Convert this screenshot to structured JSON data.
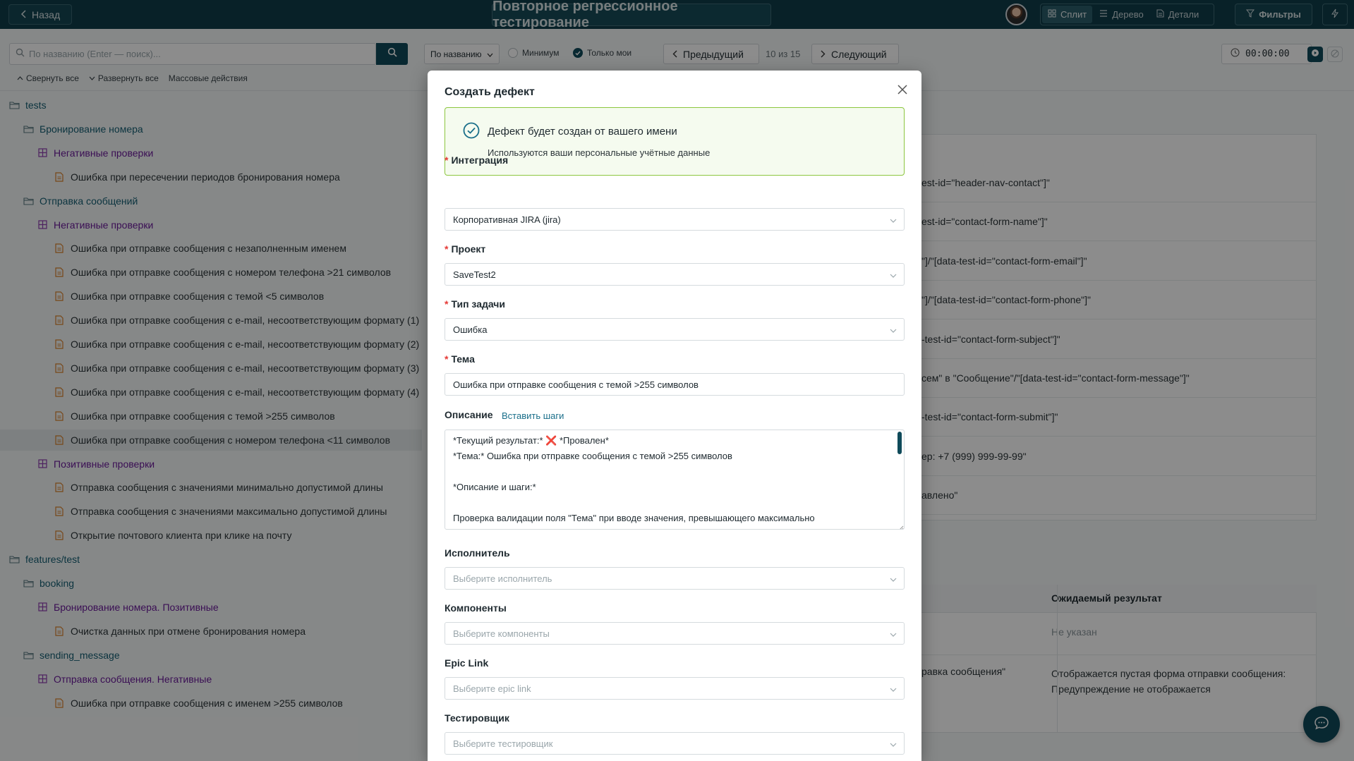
{
  "topbar": {
    "back_label": "Назад",
    "title": "Повторное регрессионное тестирование",
    "views": [
      {
        "label": "Сплит",
        "icon": "grid-icon",
        "active": true
      },
      {
        "label": "Дерево",
        "icon": "list-icon",
        "active": false
      },
      {
        "label": "Детали",
        "icon": "document-icon",
        "active": false
      }
    ],
    "filters_label": "Фильтры"
  },
  "toolbar": {
    "search_placeholder": "По названию (Enter — поиск)...",
    "sort_value": "По названию",
    "minimum_label": "Минимум",
    "only_mine_label": "Только мои",
    "prev_label": "Предыдущий",
    "counter": "10 из 15",
    "next_label": "Следующий",
    "timer": "00:00:00",
    "collapse_all": "Свернуть все",
    "expand_all": "Развернуть все",
    "bulk_actions": "Массовые действия"
  },
  "tree": [
    {
      "type": "folder",
      "label": "tests",
      "level": 0
    },
    {
      "type": "folder",
      "label": "Бронирование номера",
      "level": 1
    },
    {
      "type": "suite",
      "label": "Негативные проверки",
      "level": 2
    },
    {
      "type": "case",
      "label": "Ошибка при пересечении периодов бронирования номера",
      "level": 3
    },
    {
      "type": "folder",
      "label": "Отправка сообщений",
      "level": 1
    },
    {
      "type": "suite",
      "label": "Негативные проверки",
      "level": 2
    },
    {
      "type": "case",
      "label": "Ошибка при отправке сообщения с незаполненным именем",
      "level": 3
    },
    {
      "type": "case",
      "label": "Ошибка при отправке сообщения с номером телефона >21 символов",
      "level": 3
    },
    {
      "type": "case",
      "label": "Ошибка при отправке сообщения с темой <5 символов",
      "level": 3
    },
    {
      "type": "case",
      "label": "Ошибка при отправке сообщения с e-mail, несоответствующим формату (1)",
      "level": 3
    },
    {
      "type": "case",
      "label": "Ошибка при отправке сообщения с e-mail, несоответствующим формату (2)",
      "level": 3
    },
    {
      "type": "case",
      "label": "Ошибка при отправке сообщения с e-mail, несоответствующим формату (3)",
      "level": 3
    },
    {
      "type": "case",
      "label": "Ошибка при отправке сообщения с e-mail, несоответствующим формату (4)",
      "level": 3
    },
    {
      "type": "case",
      "label": "Ошибка при отправке сообщения с темой >255 символов",
      "level": 3
    },
    {
      "type": "case",
      "label": "Ошибка при отправке сообщения с номером телефона <11 символов",
      "level": 3,
      "selected": true
    },
    {
      "type": "suite",
      "label": "Позитивные проверки",
      "level": 2
    },
    {
      "type": "case",
      "label": "Отправка сообщения с значениями минимально допустимой длины",
      "level": 3
    },
    {
      "type": "case",
      "label": "Отправка сообщения с значениями максимально допустимой длины",
      "level": 3
    },
    {
      "type": "case",
      "label": "Открытие почтового клиента при клике на почту",
      "level": 3
    },
    {
      "type": "folder",
      "label": "features/test",
      "level": 0
    },
    {
      "type": "folder",
      "label": "booking",
      "level": 1
    },
    {
      "type": "suite",
      "label": "Бронирование номера. Позитивные",
      "level": 2
    },
    {
      "type": "case",
      "label": "Очистка данных при отмене бронирования номера",
      "level": 3
    },
    {
      "type": "folder",
      "label": "sending_message",
      "level": 1
    },
    {
      "type": "suite",
      "label": "Отправка сообщения. Негативные",
      "level": 2
    },
    {
      "type": "case",
      "label": "Ошибка при отправке сообщения с именем >255 символов",
      "level": 3
    }
  ],
  "content": {
    "steps": [
      "est-id=\"header-nav-contact\"]\"",
      "est-id=\"contact-form-name\"]\"",
      "\"]/\"[data-test-id=\"contact-form-email\"]\"",
      "\"]/\"[data-test-id=\"contact-form-phone\"]\"",
      "-test-id=\"contact-form-subject\"]\"",
      "сем\" в \"Сообщение\"/\"[data-test-id=\"contact-form-message\"]\"",
      "-test-id=\"contact-form-submit\"]\"",
      "ер: +7 (999) 999-99-99\"",
      "авлено\""
    ],
    "expected_header": "Ожидаемый результат",
    "expected_rows": [
      {
        "left": "",
        "right": "Не указан"
      },
      {
        "left": "равка сообщения\"",
        "right": "Отображается пустая форма отправки сообщения: Предупреждение не отображается"
      }
    ]
  },
  "modal": {
    "title": "Создать дефект",
    "notice_title": "Дефект будет создан от вашего имени",
    "notice_sub": "Используются ваши персональные учётные данные",
    "integration_label": "Интеграция",
    "integration_value": "Корпоративная JIRA (jira)",
    "project_label": "Проект",
    "project_value": "SaveTest2",
    "task_type_label": "Тип задачи",
    "task_type_value": "Ошибка",
    "subject_label": "Тема",
    "subject_value": "Ошибка при отправке сообщения с темой >255 символов",
    "description_label": "Описание",
    "insert_steps_label": "Вставить шаги",
    "description_lines": [
      "*Текущий результат:* ❌ *Провален*",
      "*Тема:* Ошибка при отправке сообщения с темой >255 символов",
      "",
      "*Описание и шаги:*",
      "",
      "Проверка валидации поля \"Тема\" при вводе значения, превышающего максимально"
    ],
    "assignee_label": "Исполнитель",
    "assignee_placeholder": "Выберите исполнитель",
    "components_label": "Компоненты",
    "components_placeholder": "Выберите компоненты",
    "epic_label": "Epic Link",
    "epic_placeholder": "Выберите epic link",
    "tester_label": "Тестировщик",
    "tester_placeholder": "Выберите тестировщик"
  },
  "colors": {
    "brand": "#0f3d4a",
    "primary": "#0f4a5a",
    "success_border": "#8cc63f",
    "required": "#e53935"
  }
}
